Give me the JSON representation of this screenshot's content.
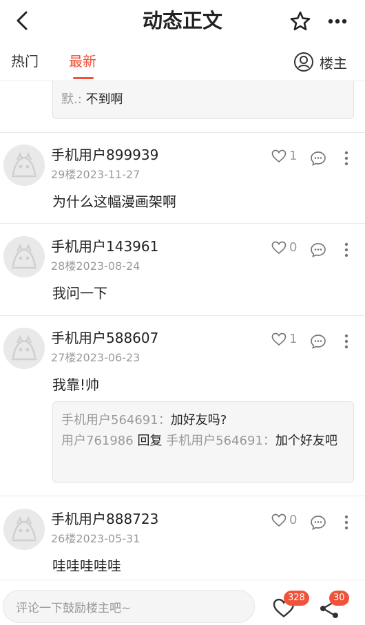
{
  "header": {
    "title": "动态正文",
    "icons": {
      "back": "back-arrow-icon",
      "star": "star-outline-icon",
      "more": "more-dots-icon"
    }
  },
  "tabs": {
    "hot": "热门",
    "latest": "最新",
    "owner_only": "楼主",
    "active_color": "#f0533a"
  },
  "top_reply": {
    "user": "默.:",
    "text": "不到啊"
  },
  "comments": [
    {
      "username": "手机用户899939",
      "floor": "29楼",
      "date": "2023-11-27",
      "text": "为什么这幅漫画架啊",
      "likes": "1"
    },
    {
      "username": "手机用户143961",
      "floor": "28楼",
      "date": "2023-08-24",
      "text": "我问一下",
      "likes": "0"
    },
    {
      "username": "手机用户588607",
      "floor": "27楼",
      "date": "2023-06-23",
      "text": "我靠!帅",
      "likes": "1",
      "replies": [
        {
          "user": "手机用户564691：",
          "text": "加好友吗?"
        },
        {
          "user": "用户761986",
          "verb": "回复",
          "target": "手机用户564691：",
          "text": "加个好友吧"
        }
      ]
    },
    {
      "username": "手机用户888723",
      "floor": "26楼",
      "date": "2023-05-31",
      "text": "哇哇哇哇哇",
      "likes": "0"
    }
  ],
  "bottom_bar": {
    "input_placeholder": "评论一下鼓励楼主吧~",
    "like_count": "328",
    "share_count": "30",
    "badge_color": "#f0533a"
  }
}
